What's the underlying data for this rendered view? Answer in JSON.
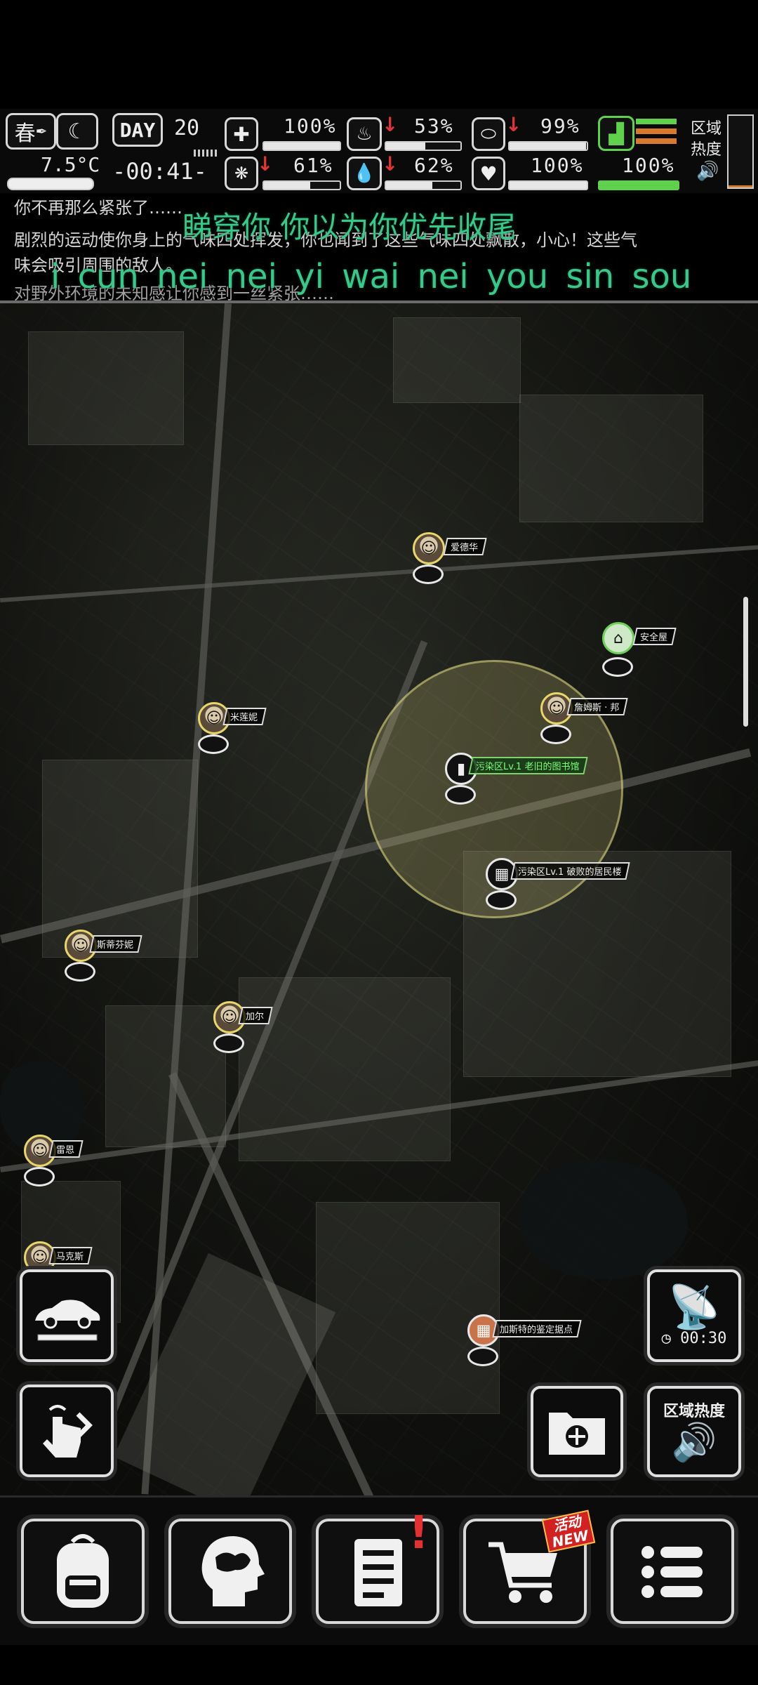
{
  "status": {
    "season": "春",
    "season_extra": "",
    "temperature": "7.5°C",
    "day_label": "DAY",
    "day_number": "20",
    "clock": "-00:41-",
    "stats": {
      "health": {
        "value": "100%",
        "fraction": 1.0
      },
      "hunger": {
        "value": "53%",
        "fraction": 0.53,
        "trend": "down"
      },
      "armor": {
        "value": "99%",
        "fraction": 0.99,
        "trend": "down"
      },
      "sanity": {
        "value": "61%",
        "fraction": 0.61,
        "trend": "down"
      },
      "thirst": {
        "value": "62%",
        "fraction": 0.62,
        "trend": "down"
      },
      "mood": {
        "value": "100%",
        "fraction": 1.0
      },
      "stamina": {
        "value": "100%",
        "fraction": 1.0
      }
    },
    "zone_heat_label_1": "区域",
    "zone_heat_label_2": "热度",
    "colors": {
      "accent_green": "#5fd14c",
      "alert_red": "#e03535",
      "zone_yellow": "#d6d27a"
    }
  },
  "messages": {
    "line0": "你不再那么紧张了……",
    "line1": "剧烈的运动使你身上的气味四处挥发，你也闻到了这些气味四处飘散，小心！这些气",
    "line2": "味会吸引周围的敌人。",
    "line3": "对野外环境的未知感让你感到一丝紧张……"
  },
  "lyrics": {
    "line1": "睇穿你 你以为你优先收尾",
    "line2": "i cun nei    nei yi wai nei you sin sou"
  },
  "map": {
    "characters": [
      {
        "name": "爱德华"
      },
      {
        "name": "安全屋"
      },
      {
        "name": "米莲妮"
      },
      {
        "name": "詹姆斯 · 邦"
      },
      {
        "name": "斯蒂芬妮"
      },
      {
        "name": "加尔"
      },
      {
        "name": "雷恩"
      },
      {
        "name": "马克斯"
      }
    ],
    "locations": {
      "library": "污染区Lv.1 老旧的图书馆",
      "residential": "污染区Lv.1 破败的居民楼",
      "appraisal": "加斯特的鉴定据点"
    }
  },
  "controls": {
    "radar_timer": "00:30",
    "zone_heat_button": "区域热度",
    "activity_badge_1": "活动",
    "activity_badge_2": "NEW",
    "quest_alert": "!"
  }
}
